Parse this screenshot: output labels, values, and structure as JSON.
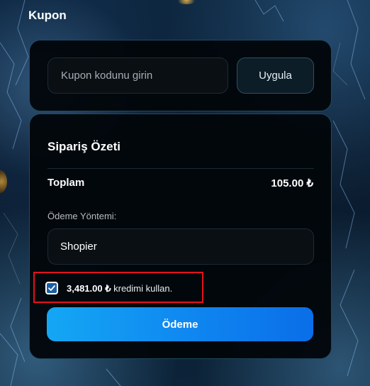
{
  "coupon": {
    "section_title": "Kupon",
    "input_placeholder": "Kupon kodunu girin",
    "apply_label": "Uygula"
  },
  "summary": {
    "title": "Sipariş Özeti",
    "total_label": "Toplam",
    "total_value": "105.00 ₺",
    "payment_method_label": "Ödeme Yöntemi:",
    "payment_method_value": "Shopier"
  },
  "credit": {
    "checked": true,
    "amount": "3,481.00 ₺",
    "text": " kredimi kullan."
  },
  "pay_button_label": "Ödeme",
  "colors": {
    "accent": "#0f86f0",
    "highlight": "#e4121b",
    "card_border": "#1f4a63"
  },
  "icons": {
    "checkbox": "check-icon"
  }
}
